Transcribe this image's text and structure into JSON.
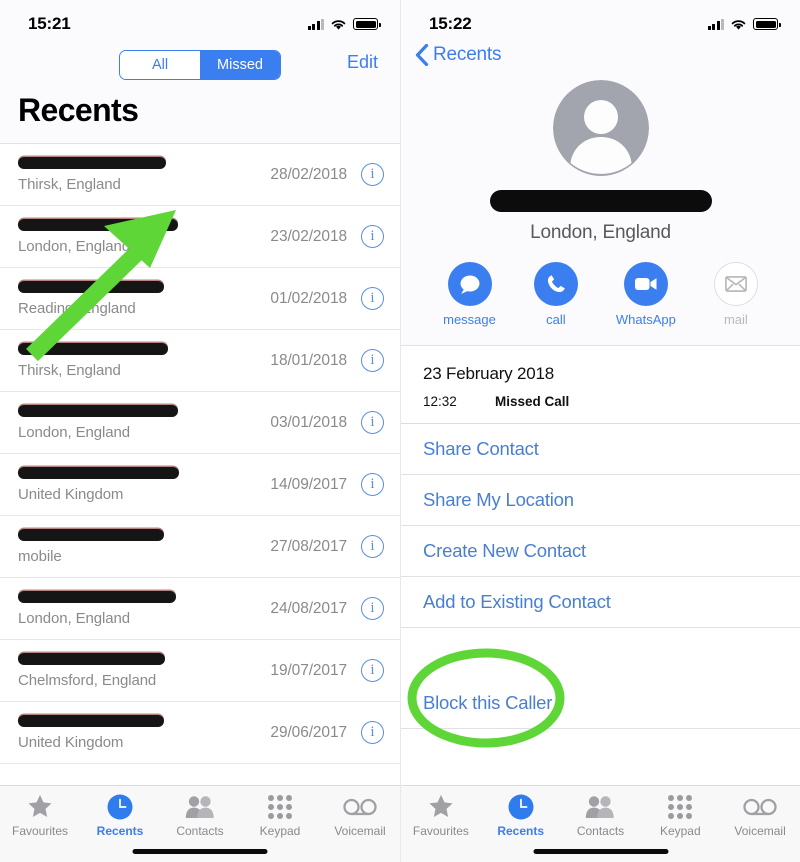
{
  "left_screen": {
    "status": {
      "time": "15:21",
      "signal_icon": "cellular-signal-icon",
      "wifi_icon": "wifi-icon",
      "battery_icon": "battery-full-icon"
    },
    "segmented": {
      "options": [
        "All",
        "Missed"
      ],
      "selected": "Missed"
    },
    "edit_label": "Edit",
    "page_title": "Recents",
    "calls": [
      {
        "number": "REDACTED",
        "location": "Thirsk, England",
        "date": "28/02/2018",
        "info_icon": "info-circle-icon"
      },
      {
        "number": "REDACTED",
        "location": "London, England",
        "date": "23/02/2018",
        "info_icon": "info-circle-icon"
      },
      {
        "number": "REDACTED",
        "location": "Reading, England",
        "date": "01/02/2018",
        "info_icon": "info-circle-icon"
      },
      {
        "number": "REDACTED",
        "location": "Thirsk, England",
        "date": "18/01/2018",
        "info_icon": "info-circle-icon"
      },
      {
        "number": "REDACTED",
        "location": "London, England",
        "date": "03/01/2018",
        "info_icon": "info-circle-icon"
      },
      {
        "number": "REDACTED",
        "location": "United Kingdom",
        "date": "14/09/2017",
        "info_icon": "info-circle-icon"
      },
      {
        "number": "REDACTED",
        "location": "mobile",
        "date": "27/08/2017",
        "info_icon": "info-circle-icon"
      },
      {
        "number": "REDACTED",
        "location": "London, England",
        "date": "24/08/2017",
        "info_icon": "info-circle-icon"
      },
      {
        "number": "REDACTED",
        "location": "Chelmsford, England",
        "date": "19/07/2017",
        "info_icon": "info-circle-icon"
      },
      {
        "number": "REDACTED",
        "location": "United Kingdom",
        "date": "29/06/2017",
        "info_icon": "info-circle-icon"
      }
    ]
  },
  "right_screen": {
    "status": {
      "time": "15:22",
      "signal_icon": "cellular-signal-icon",
      "wifi_icon": "wifi-icon",
      "battery_icon": "battery-full-icon"
    },
    "back_label": "Recents",
    "back_icon": "chevron-left-icon",
    "contact": {
      "avatar_icon": "person-placeholder-avatar-icon",
      "name": "REDACTED",
      "location": "London, England"
    },
    "actions": [
      {
        "label": "message",
        "icon": "message-bubble-icon",
        "enabled": true
      },
      {
        "label": "call",
        "icon": "phone-handset-icon",
        "enabled": true
      },
      {
        "label": "WhatsApp",
        "icon": "video-camera-icon",
        "enabled": true
      },
      {
        "label": "mail",
        "icon": "envelope-icon",
        "enabled": false
      }
    ],
    "call_detail": {
      "date": "23 February 2018",
      "time": "12:32",
      "type": "Missed Call"
    },
    "menu_items": [
      "Share Contact",
      "Share My Location",
      "Create New Contact",
      "Add to Existing Contact",
      "Block this Caller"
    ]
  },
  "tabbar": {
    "items": [
      {
        "label": "Favourites",
        "icon": "star-icon",
        "active": false
      },
      {
        "label": "Recents",
        "icon": "clock-icon",
        "active": true
      },
      {
        "label": "Contacts",
        "icon": "people-icon",
        "active": false
      },
      {
        "label": "Keypad",
        "icon": "keypad-dots-icon",
        "active": false
      },
      {
        "label": "Voicemail",
        "icon": "voicemail-icon",
        "active": false
      }
    ]
  },
  "annotations": {
    "arrow": {
      "shape": "arrow",
      "color": "#5FD637",
      "points_to": "info-button-of-23-02-2018-row"
    },
    "circle": {
      "shape": "ellipse",
      "color": "#5FD637",
      "encircles": "Block this Caller"
    }
  },
  "colors": {
    "accent_blue": "#3b7ef0",
    "link_blue": "#4a7fd0",
    "annotation_green": "#5FD637",
    "subtle_gray": "#8a8a8e"
  }
}
